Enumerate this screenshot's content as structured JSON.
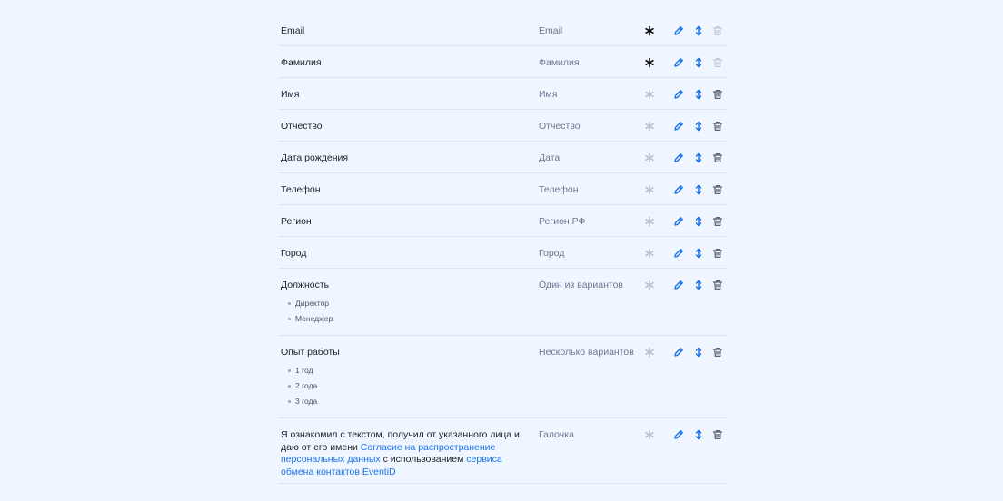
{
  "colors": {
    "accent": "#1a73e8",
    "required_on": "#111111",
    "required_off": "#b9c2cf",
    "trash": "#5a6372",
    "trash_disabled": "#c6ccd6",
    "background": "#f0f6ff"
  },
  "fields": [
    {
      "label": "Email",
      "type": "Email",
      "required": true,
      "deletable": false
    },
    {
      "label": "Фамилия",
      "type": "Фамилия",
      "required": true,
      "deletable": false
    },
    {
      "label": "Имя",
      "type": "Имя",
      "required": false,
      "deletable": true
    },
    {
      "label": "Отчество",
      "type": "Отчество",
      "required": false,
      "deletable": true
    },
    {
      "label": "Дата рождения",
      "type": "Дата",
      "required": false,
      "deletable": true
    },
    {
      "label": "Телефон",
      "type": "Телефон",
      "required": false,
      "deletable": true
    },
    {
      "label": "Регион",
      "type": "Регион РФ",
      "required": false,
      "deletable": true
    },
    {
      "label": "Город",
      "type": "Город",
      "required": false,
      "deletable": true
    },
    {
      "label": "Должность",
      "type": "Один из вариантов",
      "required": false,
      "deletable": true,
      "options": [
        "Директор",
        "Менеджер"
      ]
    },
    {
      "label": "Опыт работы",
      "type": "Несколько вариантов",
      "required": false,
      "deletable": true,
      "options": [
        "1 год",
        "2 года",
        "3 года"
      ]
    },
    {
      "label": "",
      "type": "Галочка",
      "required": false,
      "deletable": true,
      "rich": [
        {
          "text": "Я ознакомил с текстом, получил от указанного лица и даю от его имени ",
          "link": false
        },
        {
          "text": "Согласие на распространение персональных данных",
          "link": true
        },
        {
          "text": " с использованием ",
          "link": false
        },
        {
          "text": "сервиса обмена контактов EventiD",
          "link": true
        }
      ]
    }
  ],
  "icons": {
    "required": "asterisk-icon",
    "edit": "pencil-icon",
    "move": "up-down-arrow-icon",
    "delete": "trash-icon"
  }
}
